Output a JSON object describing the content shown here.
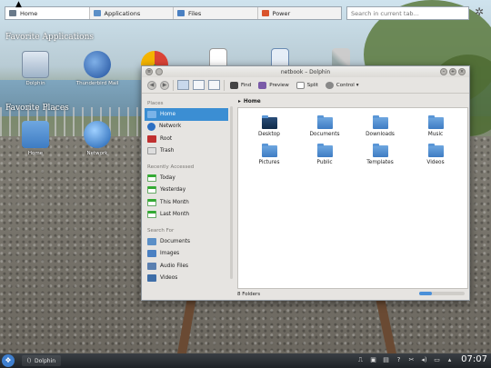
{
  "launcher": {
    "tabs": [
      {
        "label": "Home",
        "icon": "home-icon",
        "active": true
      },
      {
        "label": "Applications",
        "icon": "applications-icon",
        "active": false
      },
      {
        "label": "Files",
        "icon": "files-icon",
        "active": false
      },
      {
        "label": "Power",
        "icon": "power-icon",
        "active": false
      }
    ],
    "search_placeholder": "Search in current tab..."
  },
  "desktop": {
    "favorite_apps_title": "Favorite Applications",
    "favorite_places_title": "Favorite Places",
    "apps": [
      {
        "label": "Dolphin",
        "icon": "dolphin-icon"
      },
      {
        "label": "Thunderbird Mail",
        "icon": "thunderbird-icon"
      }
    ],
    "places": [
      {
        "label": "Home",
        "icon": "home-folder-icon"
      },
      {
        "label": "Network",
        "icon": "network-globe-icon"
      }
    ]
  },
  "window": {
    "title": "netbook – Dolphin",
    "toolbar": {
      "find": "Find",
      "preview": "Preview",
      "split": "Split",
      "control": "Control"
    },
    "breadcrumb": "Home",
    "sidebar": {
      "places_header": "Places",
      "places": [
        {
          "label": "Home",
          "icon": "home-icon",
          "selected": true
        },
        {
          "label": "Network",
          "icon": "network-icon",
          "selected": false
        },
        {
          "label": "Root",
          "icon": "root-folder-icon",
          "selected": false
        },
        {
          "label": "Trash",
          "icon": "trash-icon",
          "selected": false
        }
      ],
      "recent_header": "Recently Accessed",
      "recent": [
        {
          "label": "Today",
          "icon": "calendar-icon"
        },
        {
          "label": "Yesterday",
          "icon": "calendar-icon"
        },
        {
          "label": "This Month",
          "icon": "calendar-icon"
        },
        {
          "label": "Last Month",
          "icon": "calendar-icon"
        }
      ],
      "search_header": "Search For",
      "search": [
        {
          "label": "Documents",
          "icon": "documents-icon"
        },
        {
          "label": "Images",
          "icon": "images-icon"
        },
        {
          "label": "Audio Files",
          "icon": "audio-icon"
        },
        {
          "label": "Videos",
          "icon": "videos-icon"
        }
      ]
    },
    "files": [
      {
        "label": "Desktop",
        "icon": "desktop-folder-icon"
      },
      {
        "label": "Documents",
        "icon": "folder-icon"
      },
      {
        "label": "Downloads",
        "icon": "folder-icon"
      },
      {
        "label": "Music",
        "icon": "folder-icon"
      },
      {
        "label": "Pictures",
        "icon": "folder-icon"
      },
      {
        "label": "Public",
        "icon": "folder-icon"
      },
      {
        "label": "Templates",
        "icon": "folder-icon"
      },
      {
        "label": "Videos",
        "icon": "folder-icon"
      }
    ],
    "status": "8 Folders"
  },
  "taskbar": {
    "task_label": "Dolphin",
    "clock": "07:07"
  },
  "colors": {
    "selection": "#3b8ed3",
    "folder": "#4a8bd0",
    "panel": "#2a2e33"
  }
}
